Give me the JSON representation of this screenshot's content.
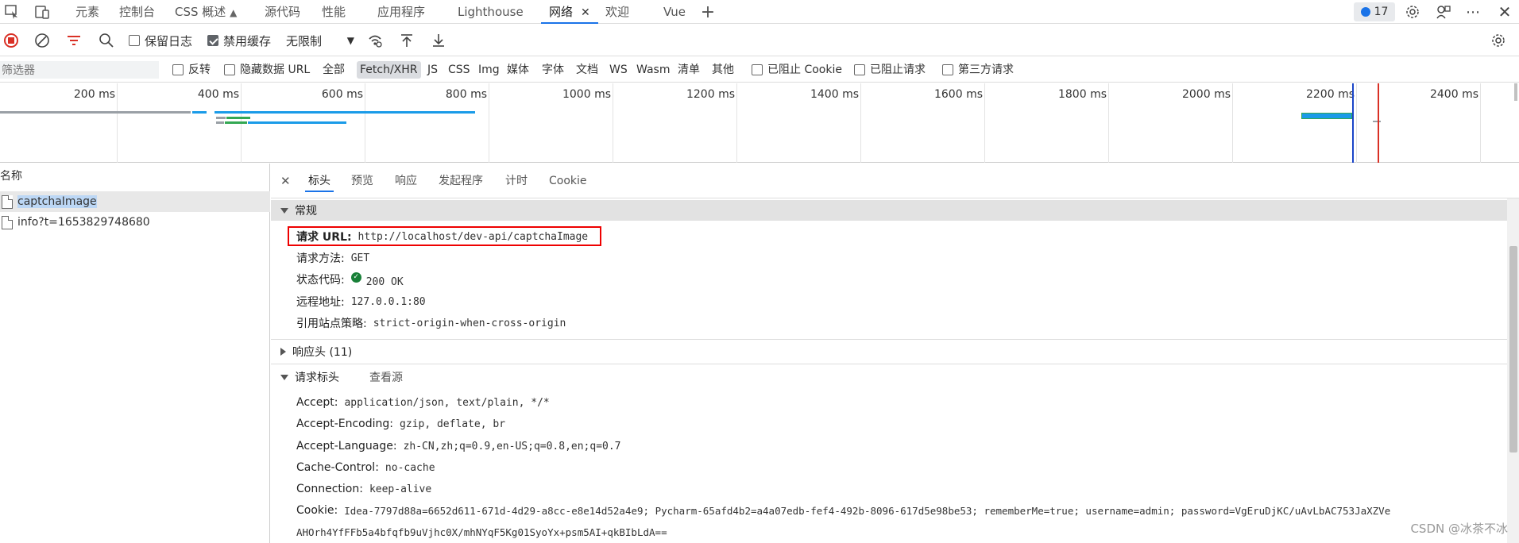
{
  "tabs": {
    "items": [
      "元素",
      "控制台",
      "CSS 概述",
      "源代码",
      "性能",
      "应用程序",
      "Lighthouse",
      "网络",
      "欢迎",
      "Vue"
    ],
    "active_index": 7,
    "css_overview_icon": "flask-icon",
    "add_tab_icon": "plus-icon",
    "message_count": "17"
  },
  "toolbar": {
    "preserve_log_label": "保留日志",
    "disable_cache_label": "禁用缓存",
    "throttle_value": "无限制"
  },
  "filter": {
    "placeholder": "筛选器",
    "invert_label": "反转",
    "hide_data_url_label": "隐藏数据 URL",
    "types": [
      "全部",
      "Fetch/XHR",
      "JS",
      "CSS",
      "Img",
      "媒体",
      "字体",
      "文档",
      "WS",
      "Wasm",
      "清单",
      "其他"
    ],
    "selected_type": "Fetch/XHR",
    "blocked_cookies_label": "已阻止 Cookie",
    "blocked_requests_label": "已阻止请求",
    "third_party_label": "第三方请求"
  },
  "timeline": {
    "ticks": [
      "200 ms",
      "400 ms",
      "600 ms",
      "800 ms",
      "1000 ms",
      "1200 ms",
      "1400 ms",
      "1600 ms",
      "1800 ms",
      "2000 ms",
      "2200 ms",
      "2400 ms"
    ]
  },
  "requests": {
    "header": "名称",
    "items": [
      "captchaImage",
      "info?t=1653829748680"
    ],
    "selected_index": 0
  },
  "detail": {
    "tabs": [
      "标头",
      "预览",
      "响应",
      "发起程序",
      "计时",
      "Cookie"
    ],
    "active_tab": "标头",
    "general": {
      "title": "常规",
      "request_url_key": "请求 URL:",
      "request_url": "http://localhost/dev-api/captchaImage",
      "method_key": "请求方法:",
      "method": "GET",
      "status_key": "状态代码:",
      "status": "200 OK",
      "remote_key": "远程地址:",
      "remote": "127.0.0.1:80",
      "referrer_key": "引用站点策略:",
      "referrer": "strict-origin-when-cross-origin"
    },
    "response_headers_title": "响应头 (11)",
    "request_headers": {
      "title": "请求标头",
      "view_source": "查看源",
      "items": [
        {
          "k": "Accept:",
          "v": "application/json, text/plain, */*"
        },
        {
          "k": "Accept-Encoding:",
          "v": "gzip, deflate, br"
        },
        {
          "k": "Accept-Language:",
          "v": "zh-CN,zh;q=0.9,en-US;q=0.8,en;q=0.7"
        },
        {
          "k": "Cache-Control:",
          "v": "no-cache"
        },
        {
          "k": "Connection:",
          "v": "keep-alive"
        },
        {
          "k": "Cookie:",
          "v": "Idea-7797d88a=6652d611-671d-4d29-a8cc-e8e14d52a4e9; Pycharm-65afd4b2=a4a07edb-fef4-492b-8096-617d5e98be53; rememberMe=true; username=admin; password=VgEruDjKC/uAvLbAC753JaXZVe"
        }
      ],
      "cookie_cont": "AHOrh4YfFFb5a4bfqfb9uVjhc0X/mhNYqF5Kg01SyoYx+psm5AI+qkBIbLdA=="
    }
  },
  "watermark": "CSDN @冰茶不冰",
  "colors": {
    "accent": "#1a73e8",
    "record_red": "#d93025",
    "status_green": "#188038",
    "highlight_box": "#e00000"
  }
}
